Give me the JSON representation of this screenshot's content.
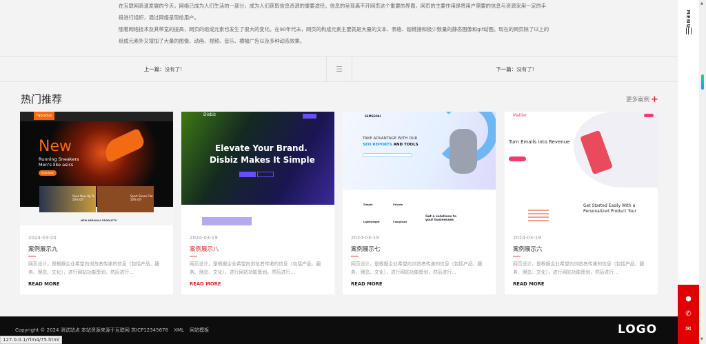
{
  "article": {
    "paragraphs": [
      "在互联网高速发展的今天，网络已成为人们生活的一部分，成为人们获取信息资源的重要途径。信息的呈现离不开网页这个重要的界面，网页的主要作用是将用户需要的信息与资源采用一定的手",
      "段进行组织，通过网络呈现给用户。",
      "随着网络技术及其带宽的提高，网页的组成元素也发生了很大的变化。在90年代末，网页的构成元素主要就是大量的文本、表格、超链接和极少数量的静态图像和gif动图。现在的网页除了以上的",
      "组成元素外又增加了大量的图像、动画、视频、音乐、横幅广告以及多种动态效果。"
    ]
  },
  "nav": {
    "prev_label": "上一篇：",
    "prev_value": "没有了!",
    "next_label": "下一篇：",
    "next_value": "没有了!"
  },
  "section": {
    "title": "热门推荐",
    "more": "更多案例",
    "more_icon": "+"
  },
  "cards": [
    {
      "date": "2024-03-20",
      "title": "案例展示九",
      "desc": "网页设计，是根据企业希望向浏览者传递的信息（包括产品、服务、理念、文化），进行网站功能策划，然后进行…",
      "read_more": "READ MORE",
      "img": {
        "brand": "Fabulous",
        "h1": "New",
        "h2": "Running Sneakers",
        "h3": "Men's like asics",
        "btn": "Shop Now",
        "promo1": "Save Now Up To 50% Off",
        "promo2": "Sport Shoes Flat 50% Off",
        "footer": "NEW ARRIVALS PRODUCTS"
      }
    },
    {
      "date": "2024-03-19",
      "title": "案例展示八",
      "desc": "网页设计，是根据企业希望向浏览者传递的信息（包括产品、服务、理念、文化），进行网站功能策划，然后进行…",
      "read_more": "READ MORE",
      "img": {
        "brand": "Disbiz",
        "h1": "Elevate Your Brand.",
        "h2": "Disbiz Makes It Simple"
      }
    },
    {
      "date": "2024-03-19",
      "title": "案例展示七",
      "desc": "网页设计，是根据企业希望向浏览者传递的信息（包括产品、服务、理念、文化），进行网站功能策划，然后进行…",
      "read_more": "READ MORE",
      "img": {
        "brand": "SEMSEOAI",
        "h1": "TAKE ADVANTAGE WITH OUR",
        "h2a": "SEO REPORTS",
        "h2b": "AND TOOLS",
        "f1": "Simple",
        "f2": "Private",
        "f3": "Lightweight",
        "f4": "Compliant",
        "sub": "Get a solutions to your businesses"
      }
    },
    {
      "date": "2024-03-19",
      "title": "案例展示六",
      "desc": "网页设计，是根据企业希望向浏览者传递的信息（包括产品、服务、理念、文化），进行网站功能策划，然后进行…",
      "read_more": "READ MORE",
      "img": {
        "brand": "Mailler",
        "h1": "Turn Emails into Revenue",
        "sub1": "Get Started Easily With a",
        "sub2": "Personalized Product Tour"
      }
    }
  ],
  "footer": {
    "copyright": "Copyright © 2024 测试站点 本站资源来源于互联网 苏ICP12345678",
    "xml": "XML",
    "map": "网站模板",
    "logo": "LOGO"
  },
  "sidebar": {
    "menu": "MENU"
  },
  "status_url": "127.0.0.1/?lm4/75.html",
  "colors": {
    "accent": "#e0262a",
    "footer_bg": "#0d0d0d",
    "float_bg": "#e00000"
  }
}
